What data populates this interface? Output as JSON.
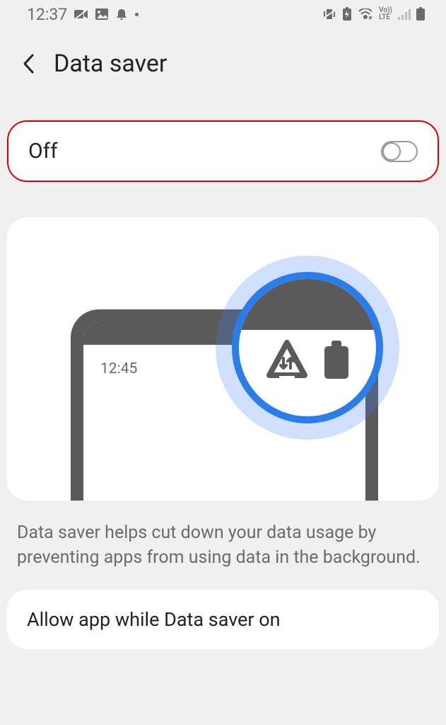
{
  "status_bar": {
    "clock": "12:37",
    "lte_label": "Vo))\nLTE"
  },
  "header": {
    "title": "Data saver"
  },
  "toggle": {
    "state_label": "Off"
  },
  "illustration": {
    "phone_clock": "12:45"
  },
  "description": "Data saver helps cut down your data usage by preventing apps from using data in the background.",
  "allow_row": {
    "label": "Allow app while Data saver on"
  }
}
